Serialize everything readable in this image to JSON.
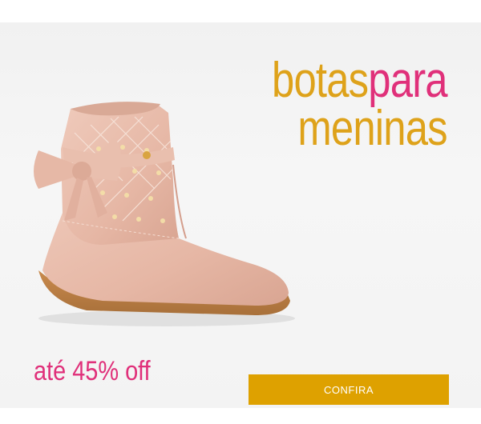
{
  "headline": {
    "line1_part1": "botas",
    "line1_part2": "para",
    "line2": "meninas"
  },
  "promo": {
    "discount_text": "até 45% off"
  },
  "cta": {
    "label": "CONFIRA"
  },
  "image": {
    "icon": "girls-pink-ankle-boot-with-bow-image"
  },
  "colors": {
    "gold": "#dea21a",
    "pink": "#e0307a",
    "button": "#dea100",
    "background": "#f3f3f3"
  }
}
